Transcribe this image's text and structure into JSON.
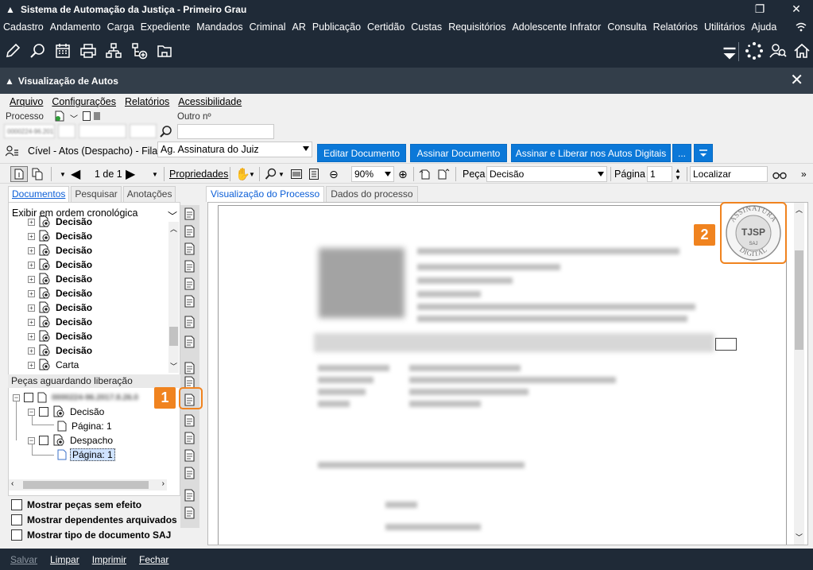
{
  "window": {
    "title": "Sistema de Automação da Justiça - Primeiro Grau"
  },
  "menu": [
    "Cadastro",
    "Andamento",
    "Carga",
    "Expediente",
    "Mandados",
    "Criminal",
    "AR",
    "Publicação",
    "Certidão",
    "Custas",
    "Requisitórios",
    "Adolescente Infrator",
    "Consulta",
    "Relatórios",
    "Utilitários",
    "Ajuda"
  ],
  "subwindow": {
    "title": "Visualização de Autos"
  },
  "submenu": [
    "Arquivo",
    "Configurações",
    "Relatórios",
    "Acessibilidade"
  ],
  "processo": {
    "label": "Processo",
    "outro_label": "Outro nº",
    "blurred_number": "0000224-96.2017.8.26.0000",
    "outro_value": ""
  },
  "fila": {
    "label": "Cível - Atos (Despacho) - Fila:",
    "selected": "Ag. Assinatura do Juiz"
  },
  "actions": {
    "editar": "Editar Documento",
    "assinar": "Assinar Documento",
    "assinar_liberar": "Assinar e Liberar nos Autos Digitais",
    "more": "..."
  },
  "viewer_toolbar": {
    "page_of": "1 de 1",
    "propriedades": "Propriedades",
    "zoom": "90%",
    "peca_label": "Peça",
    "peca_value": "Decisão",
    "pagina_label": "Página",
    "pagina_value": "1",
    "localizar": "Localizar"
  },
  "left_tabs": {
    "documentos": "Documentos",
    "pesquisar": "Pesquisar",
    "anotacoes": "Anotações"
  },
  "order": "Exibir em ordem cronológica",
  "tree": [
    {
      "label": "Decisão"
    },
    {
      "label": "Decisão"
    },
    {
      "label": "Decisão"
    },
    {
      "label": "Decisão"
    },
    {
      "label": "Decisão"
    },
    {
      "label": "Decisão"
    },
    {
      "label": "Decisão"
    },
    {
      "label": "Decisão"
    },
    {
      "label": "Decisão"
    },
    {
      "label": "Decisão"
    },
    {
      "label": "Carta"
    }
  ],
  "pecas": {
    "header": "Peças aguardando liberação",
    "root_blur": "0000224-96.2017.8.26.0",
    "decisao": "Decisão",
    "despacho": "Despacho",
    "pagina1": "Página: 1",
    "pagina1b": "Página: 1"
  },
  "options": [
    "Mostrar peças sem efeito",
    "Mostrar dependentes arquivados",
    "Mostrar tipo de documento SAJ"
  ],
  "viewer_tabs": {
    "visualizacao": "Visualização do Processo",
    "dados": "Dados do processo"
  },
  "badges": {
    "one": "1",
    "two": "2"
  },
  "seal": {
    "top": "ASSINATURA",
    "mid": "TJSP",
    "sub": "SAJ",
    "bottom": "DIGITAL"
  },
  "bottom": {
    "salvar": "Salvar",
    "limpar": "Limpar",
    "imprimir": "Imprimir",
    "fechar": "Fechar"
  }
}
